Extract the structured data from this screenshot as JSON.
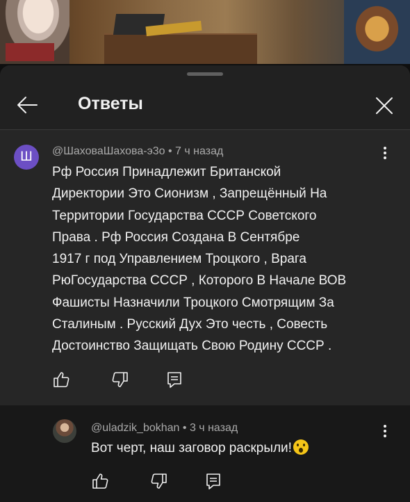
{
  "video": {
    "thumbnail_icon": "video-frame-image"
  },
  "sheet": {
    "title": "Ответы",
    "back_icon": "arrow-left-icon",
    "close_icon": "close-icon"
  },
  "main_comment": {
    "avatar_letter": "Ш",
    "avatar_color": "#6c4fc4",
    "author": "@ШаховаШахова-э3о",
    "time": "7 ч назад",
    "lines": [
      "Рф Россия Принадлежит Британской",
      "Директории Это Сионизм , Запрещённый На",
      "Территории Государства СССР Советского",
      "Права . Рф Россия Создана В Сентябре",
      "1917 г под Управлением Троцкого , Врага",
      "РюГосударства СССР , Которого В Начале ВОВ",
      "Фашисты Назначили Троцкого Смотрящим За",
      "Сталиным . Русский Дух Это честь , Совесть",
      "Достоинство Защищать Свою Родину СССР ."
    ]
  },
  "reply": {
    "author": "@uladzik_bokhan",
    "time": "3 ч назад",
    "text": "Вот черт, наш заговор раскрыли!",
    "emoji_icon": "astonished-face-emoji"
  },
  "meta_separator": "•"
}
